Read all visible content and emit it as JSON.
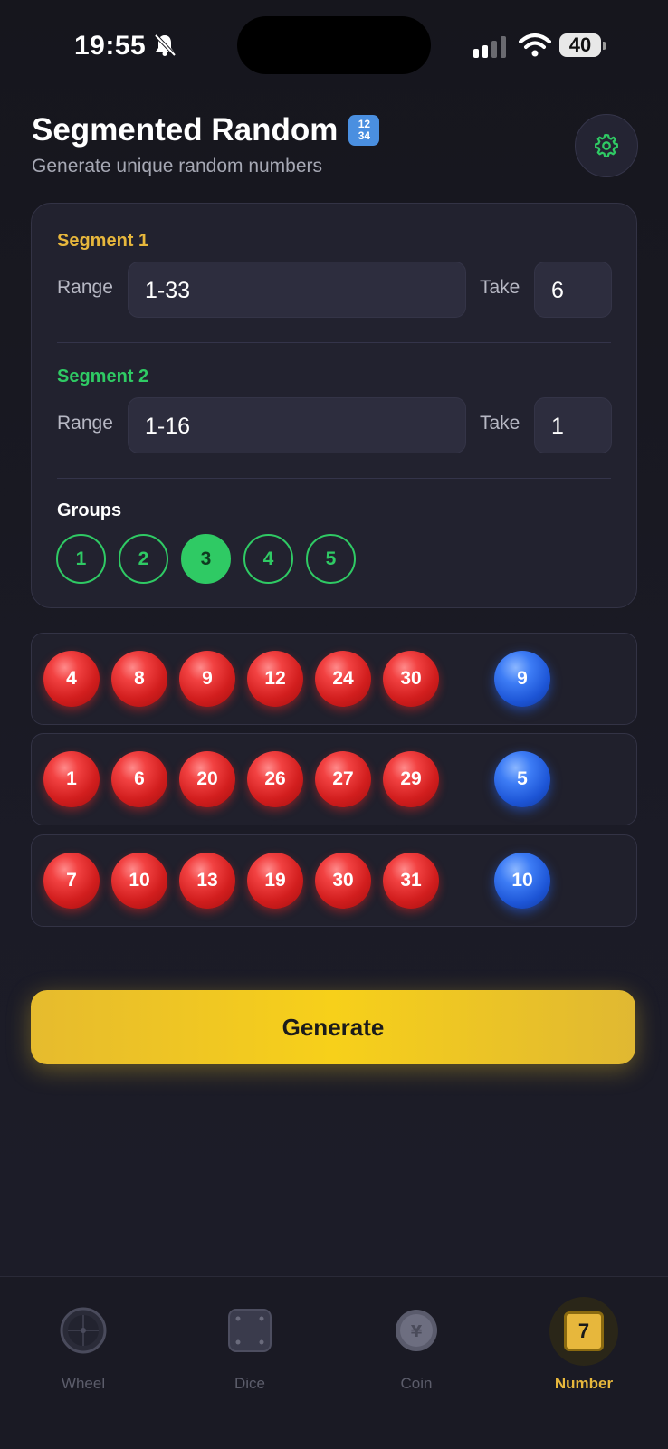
{
  "status_bar": {
    "time": "19:55",
    "battery": "40"
  },
  "header": {
    "title": "Segmented Random",
    "emoji": "🔢",
    "subtitle": "Generate unique random numbers"
  },
  "segments": [
    {
      "label": "Segment 1",
      "label_color": "#e7b73c",
      "range_label": "Range",
      "range_value": "1-33",
      "take_label": "Take",
      "take_value": "6"
    },
    {
      "label": "Segment 2",
      "label_color": "#2fca64",
      "range_label": "Range",
      "range_value": "1-16",
      "take_label": "Take",
      "take_value": "1"
    }
  ],
  "groups": {
    "label": "Groups",
    "options": [
      "1",
      "2",
      "3",
      "4",
      "5"
    ],
    "selected": "3"
  },
  "results": [
    {
      "red": [
        "4",
        "8",
        "9",
        "12",
        "24",
        "30"
      ],
      "blue": [
        "9"
      ]
    },
    {
      "red": [
        "1",
        "6",
        "20",
        "26",
        "27",
        "29"
      ],
      "blue": [
        "5"
      ]
    },
    {
      "red": [
        "7",
        "10",
        "13",
        "19",
        "30",
        "31"
      ],
      "blue": [
        "10"
      ]
    }
  ],
  "generate_label": "Generate",
  "tabs": [
    {
      "label": "Wheel",
      "icon": "wheel-icon",
      "active": false
    },
    {
      "label": "Dice",
      "icon": "dice-icon",
      "active": false
    },
    {
      "label": "Coin",
      "icon": "coin-icon",
      "active": false
    },
    {
      "label": "Number",
      "icon": "number-icon",
      "icon_text": "7",
      "active": true
    }
  ],
  "colors": {
    "accent_yellow": "#f7d01a",
    "accent_green": "#2fca64",
    "ball_red": "#e02a2a",
    "ball_blue": "#2f6de6"
  }
}
